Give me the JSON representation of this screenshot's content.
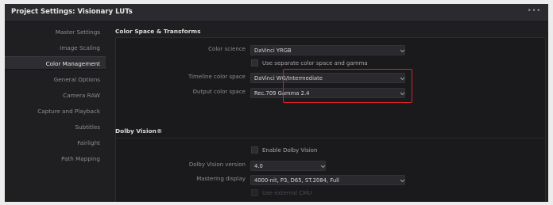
{
  "window": {
    "title": "Project Settings:  Visionary LUTs"
  },
  "sidebar": {
    "items": [
      {
        "label": "Master Settings"
      },
      {
        "label": "Image Scaling"
      },
      {
        "label": "Color Management"
      },
      {
        "label": "General Options"
      },
      {
        "label": "Camera RAW"
      },
      {
        "label": "Capture and Playback"
      },
      {
        "label": "Subtitles"
      },
      {
        "label": "Fairlight"
      },
      {
        "label": "Path Mapping"
      }
    ],
    "active_index": 2
  },
  "color_space": {
    "section_title": "Color Space & Transforms",
    "color_science": {
      "label": "Color science",
      "value": "DaVinci YRGB"
    },
    "separate_gamma": {
      "label": "Use separate color space and gamma",
      "checked": false
    },
    "timeline_color_space": {
      "label": "Timeline color space",
      "value": "DaVinci WG/Intermediate"
    },
    "output_color_space": {
      "label": "Output color space",
      "value": "Rec.709 Gamma 2.4"
    }
  },
  "dolby_vision": {
    "section_title": "Dolby Vision®",
    "enable": {
      "label": "Enable Dolby Vision",
      "checked": false
    },
    "version": {
      "label": "Dolby Vision version",
      "value": "4.0"
    },
    "mastering_display": {
      "label": "Mastering display",
      "value": "4000-nit, P3, D65, ST.2084, Full"
    },
    "external_cmu": {
      "label": "Use external CMU",
      "checked": false,
      "enabled": false
    }
  },
  "colors": {
    "highlight": "#d6232a",
    "active_item_bg": "#2e2e32"
  }
}
